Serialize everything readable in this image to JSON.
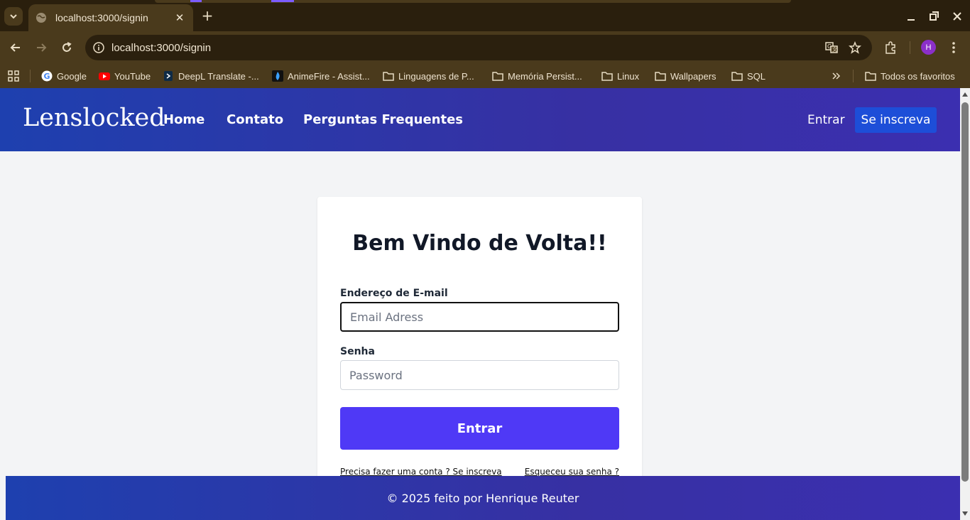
{
  "browser": {
    "tab_title": "localhost:3000/signin",
    "url": "localhost:3000/signin",
    "profile_initial": "H",
    "bookmarks": [
      {
        "label": "Google",
        "icon": "google-icon"
      },
      {
        "label": "YouTube",
        "icon": "youtube-icon"
      },
      {
        "label": "DeepL Translate -...",
        "icon": "deepl-icon"
      },
      {
        "label": "AnimeFire - Assist...",
        "icon": "animefire-icon"
      },
      {
        "label": "Linguagens de P...",
        "icon": "folder-icon"
      },
      {
        "label": "Memória Persist...",
        "icon": "folder-icon"
      },
      {
        "label": "Linux",
        "icon": "folder-icon"
      },
      {
        "label": "Wallpapers",
        "icon": "folder-icon"
      },
      {
        "label": "SQL",
        "icon": "folder-icon"
      }
    ],
    "all_bookmarks_label": "Todos os favoritos"
  },
  "site": {
    "brand": "Lenslocked",
    "nav": [
      "Home",
      "Contato",
      "Perguntas Frequentes"
    ],
    "signin_label": "Entrar",
    "signup_label": "Se inscreva"
  },
  "form": {
    "heading": "Bem Vindo de Volta!!",
    "email_label": "Endereço de E-mail",
    "email_placeholder": "Email Adress",
    "password_label": "Senha",
    "password_placeholder": "Password",
    "submit_label": "Entrar",
    "signup_prompt": "Precisa fazer uma conta ? Se inscreva",
    "forgot_password": "Esqueceu sua senha ?"
  },
  "footer": {
    "text": "© 2025 feito por Henrique Reuter"
  },
  "colors": {
    "header_gradient_start": "#1e40af",
    "header_gradient_end": "#3b2fb0",
    "signup_button": "#1d4ed8",
    "submit_button": "#4f39f6",
    "page_background": "#f3f4f6"
  }
}
